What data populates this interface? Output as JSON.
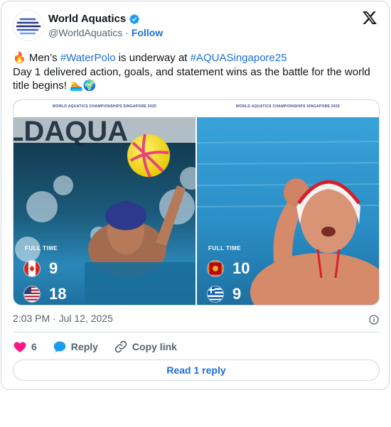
{
  "author": {
    "display_name": "World Aquatics",
    "handle": "@WorldAquatics",
    "separator": "·",
    "follow_label": "Follow",
    "avatar_icon": "world-aquatics-logo",
    "verified_icon": "verified-badge-icon"
  },
  "tweet": {
    "line1_prefix": "🔥 Men’s ",
    "hashtag1": "#WaterPolo",
    "line1_middle": " is underway at ",
    "hashtag2": "#AQUASingapore25",
    "line2": "Day 1 delivered action, goals, and statement wins as the battle for the world title begins! 🏊🌍"
  },
  "media": {
    "left": {
      "watermark": "WORLD AQUATICS CHAMPIONSHIPS SINGAPORE 2025",
      "full_time": "FULL TIME",
      "team1_flag": "canada-flag-icon",
      "team1_score": "9",
      "team2_flag": "usa-flag-icon",
      "team2_score": "18"
    },
    "right": {
      "watermark": "WORLD AQUATICS CHAMPIONSHIPS SINGAPORE 2025",
      "full_time": "FULL TIME",
      "team1_flag": "montenegro-flag-icon",
      "team1_score": "10",
      "team2_flag": "greece-flag-icon",
      "team2_score": "9"
    }
  },
  "meta": {
    "timestamp": "2:03 PM · Jul 12, 2025"
  },
  "actions": {
    "like_count": "6",
    "reply_label": "Reply",
    "copy_label": "Copy link"
  },
  "read_replies_label": "Read 1 reply",
  "colors": {
    "link": "#1d6fd0",
    "like": "#f91880",
    "reply": "#1d9bf0",
    "verified": "#1d9bf0",
    "border": "#cfd9de",
    "muted": "#536471"
  }
}
